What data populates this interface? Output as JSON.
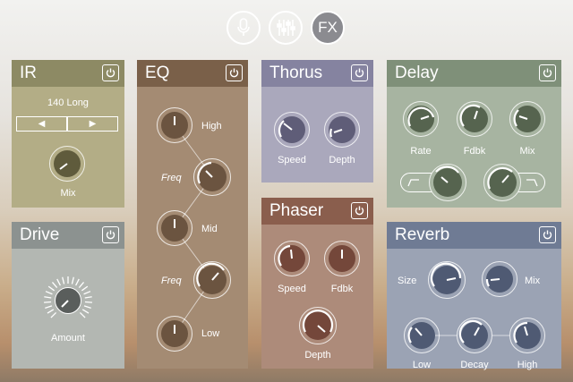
{
  "top_bar": {
    "mic_icon": "microphone-icon",
    "mixer_icon": "sliders-icon",
    "fx_label": "FX"
  },
  "ir": {
    "title": "IR",
    "preset": "140 Long",
    "prev": "◀",
    "next": "▶",
    "mix_label": "Mix"
  },
  "drive": {
    "title": "Drive",
    "amount_label": "Amount"
  },
  "eq": {
    "title": "EQ",
    "high_label": "High",
    "freq1_label": "Freq",
    "mid_label": "Mid",
    "freq2_label": "Freq",
    "low_label": "Low"
  },
  "thorus": {
    "title": "Thorus",
    "speed_label": "Speed",
    "depth_label": "Depth"
  },
  "phaser": {
    "title": "Phaser",
    "speed_label": "Speed",
    "fdbk_label": "Fdbk",
    "depth_label": "Depth"
  },
  "delay": {
    "title": "Delay",
    "rate_label": "Rate",
    "fdbk_label": "Fdbk",
    "mix_label": "Mix"
  },
  "reverb": {
    "title": "Reverb",
    "size_label": "Size",
    "mix_label": "Mix",
    "low_label": "Low",
    "decay_label": "Decay",
    "high_label": "High"
  },
  "colors": {
    "ir_header": "#8d8a64",
    "ir_body": "#b3ad86",
    "drive_header": "#8c9290",
    "drive_body": "#b3b7b2",
    "eq_header": "#7a6049",
    "eq_body": "#a48b73",
    "thorus_header": "#8583a0",
    "thorus_body": "#aaa8bc",
    "phaser_header": "#8a5e4d",
    "phaser_body": "#ad8b7a",
    "delay_header": "#7f9079",
    "delay_body": "#a7b4a1",
    "reverb_header": "#6f7b94",
    "reverb_body": "#9ba3b4"
  }
}
